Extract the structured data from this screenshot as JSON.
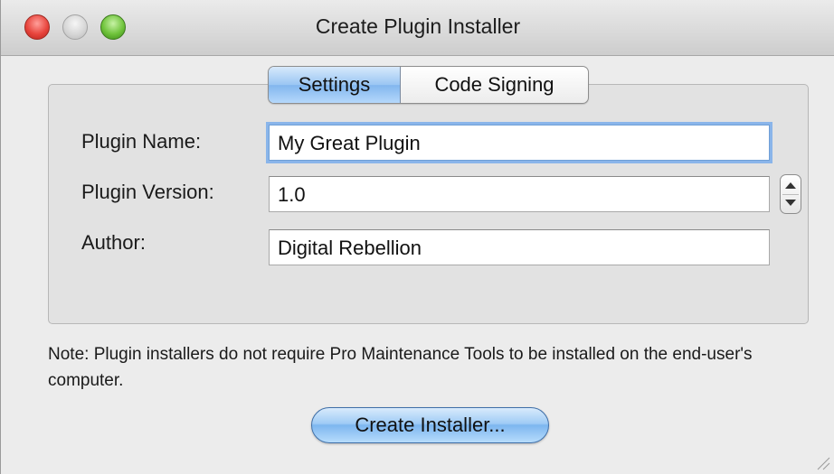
{
  "window": {
    "title": "Create Plugin Installer"
  },
  "tabs": [
    {
      "label": "Settings",
      "selected": true
    },
    {
      "label": "Code Signing",
      "selected": false
    }
  ],
  "form": {
    "plugin_name": {
      "label": "Plugin Name:",
      "value": "My Great Plugin"
    },
    "plugin_version": {
      "label": "Plugin Version:",
      "value": "1.0"
    },
    "author": {
      "label": "Author:",
      "value": "Digital Rebellion"
    }
  },
  "note": "Note: Plugin installers do not require Pro Maintenance Tools to be installed on the end-user's computer.",
  "actions": {
    "create_installer_label": "Create Installer..."
  },
  "colors": {
    "accent": "#82b6ee",
    "window_bg": "#ececec",
    "close": "#e8453d",
    "zoom": "#6fc33b"
  }
}
